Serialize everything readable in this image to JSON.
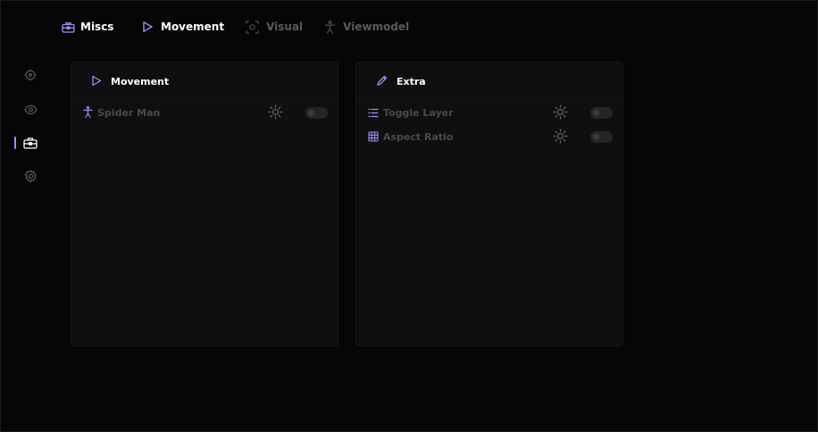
{
  "header": {
    "section_title": "Miscs",
    "tabs": [
      {
        "label": "Movement",
        "icon": "play-icon",
        "active": true
      },
      {
        "label": "Visual",
        "icon": "focus-icon",
        "active": false
      },
      {
        "label": "Viewmodel",
        "icon": "person-icon",
        "active": false
      }
    ]
  },
  "sidebar": {
    "items": [
      {
        "icon": "crosshair-icon",
        "active": false
      },
      {
        "icon": "eye-icon",
        "active": false
      },
      {
        "icon": "toolbox-icon",
        "active": true
      },
      {
        "icon": "gear-icon",
        "active": false
      }
    ]
  },
  "panels": [
    {
      "title": "Movement",
      "icon": "play-icon",
      "rows": [
        {
          "label": "Spider Man",
          "icon": "person-icon",
          "enabled": false
        }
      ]
    },
    {
      "title": "Extra",
      "icon": "pen-icon",
      "rows": [
        {
          "label": "Toggle Layer",
          "icon": "list-icon",
          "enabled": false
        },
        {
          "label": "Aspect Ratio",
          "icon": "grid-icon",
          "enabled": false
        }
      ]
    }
  ],
  "colors": {
    "accent": "#a78bfa",
    "background": "#060606",
    "panel": "#0f0f0f",
    "muted_text": "#4a4a4a"
  }
}
